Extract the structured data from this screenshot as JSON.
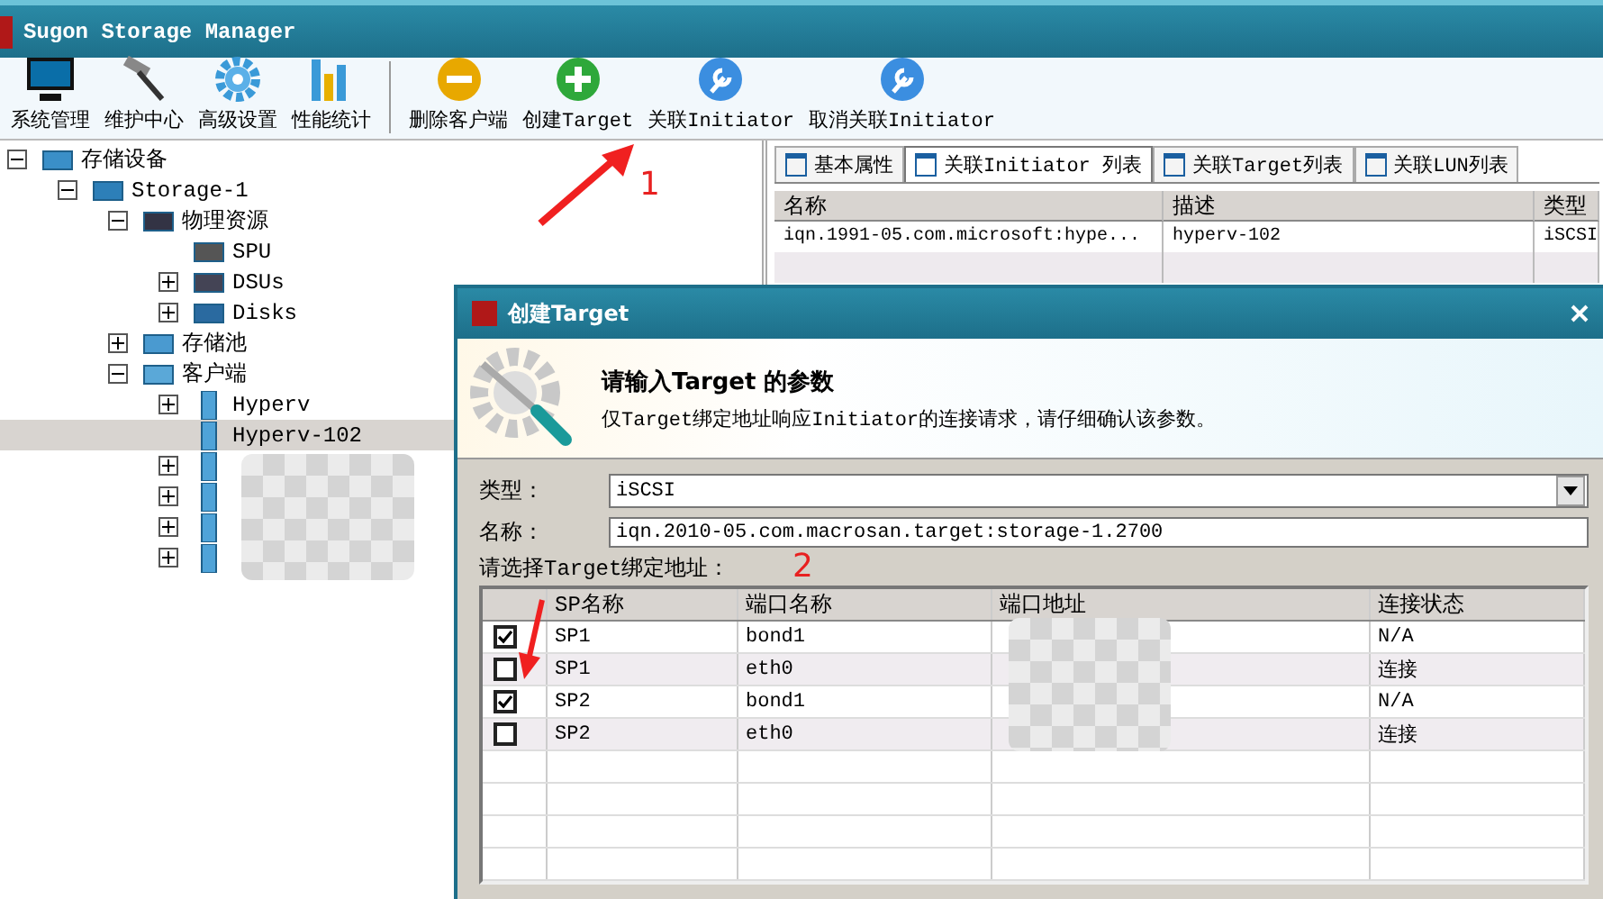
{
  "window": {
    "title": "Sugon Storage Manager"
  },
  "toolbar_groups": [
    [
      {
        "label": "系统管理",
        "kind": "monitor"
      },
      {
        "label": "维护中心",
        "kind": "hammer"
      },
      {
        "label": "高级设置",
        "kind": "gear"
      },
      {
        "label": "性能统计",
        "kind": "chart"
      }
    ],
    [
      {
        "label": "删除客户端",
        "kind": "minus"
      },
      {
        "label": "创建Target",
        "kind": "plus"
      },
      {
        "label": "关联Initiator",
        "kind": "wrench"
      },
      {
        "label": "取消关联Initiator",
        "kind": "wrench"
      }
    ]
  ],
  "tree": [
    {
      "label": "存储设备",
      "kind": "storage",
      "expanded": true,
      "selected": false,
      "children": [
        {
          "label": "Storage-1",
          "kind": "array",
          "expanded": true,
          "selected": false,
          "children": [
            {
              "label": "物理资源",
              "kind": "device",
              "expanded": true,
              "selected": false,
              "children": [
                {
                  "label": "SPU",
                  "kind": "board",
                  "selected": false
                },
                {
                  "label": "DSUs",
                  "kind": "shelf",
                  "expanded": false,
                  "selected": false
                },
                {
                  "label": "Disks",
                  "kind": "disk",
                  "expanded": false,
                  "selected": false
                }
              ]
            },
            {
              "label": "存储池",
              "kind": "pool",
              "expanded": false,
              "selected": false
            },
            {
              "label": "客户端",
              "kind": "clients",
              "expanded": true,
              "selected": false,
              "children": [
                {
                  "label": "Hyperv",
                  "kind": "host",
                  "expanded": false,
                  "selected": false
                },
                {
                  "label": "Hyperv-102",
                  "kind": "host",
                  "selected": true
                },
                {
                  "kind": "host",
                  "expanded": false,
                  "selected": false
                },
                {
                  "kind": "host",
                  "expanded": false,
                  "selected": false
                },
                {
                  "kind": "host",
                  "expanded": false,
                  "selected": false
                },
                {
                  "kind": "host",
                  "expanded": false,
                  "selected": false
                }
              ]
            }
          ]
        }
      ]
    }
  ],
  "detail": {
    "tabs": [
      {
        "label": "基本属性",
        "selected": false
      },
      {
        "label": "关联Initiator 列表",
        "selected": true
      },
      {
        "label": "关联Target列表",
        "selected": false
      },
      {
        "label": "关联LUN列表",
        "selected": false
      }
    ],
    "table": {
      "columns": [
        "名称",
        "描述",
        "类型"
      ],
      "rows": [
        [
          "iqn.1991-05.com.microsoft:hype...",
          "hyperv-102",
          "iSCSI"
        ]
      ]
    }
  },
  "dialog": {
    "title": "创建Target",
    "heading": "请输入Target 的参数",
    "description": "仅Target绑定地址响应Initiator的连接请求，请仔细确认该参数。",
    "type": {
      "label": "类型：",
      "value": "iSCSI"
    },
    "name": {
      "label": "名称：",
      "value": "iqn.2010-05.com.macrosan.target:storage-1.2700"
    },
    "prompt": "请选择Target绑定地址：",
    "bindings": {
      "columns": [
        "SP名称",
        "端口名称",
        "端口地址",
        "连接状态"
      ],
      "rows": [
        {
          "checked": true,
          "sp": "SP1",
          "port": "bond1",
          "status": "N/A"
        },
        {
          "checked": false,
          "sp": "SP1",
          "port": "eth0",
          "status": "连接"
        },
        {
          "checked": true,
          "sp": "SP2",
          "port": "bond1",
          "status": "N/A"
        },
        {
          "checked": false,
          "sp": "SP2",
          "port": "eth0",
          "status": "连接"
        }
      ]
    }
  },
  "annotations": [
    {
      "label": "1"
    },
    {
      "label": "2"
    }
  ]
}
